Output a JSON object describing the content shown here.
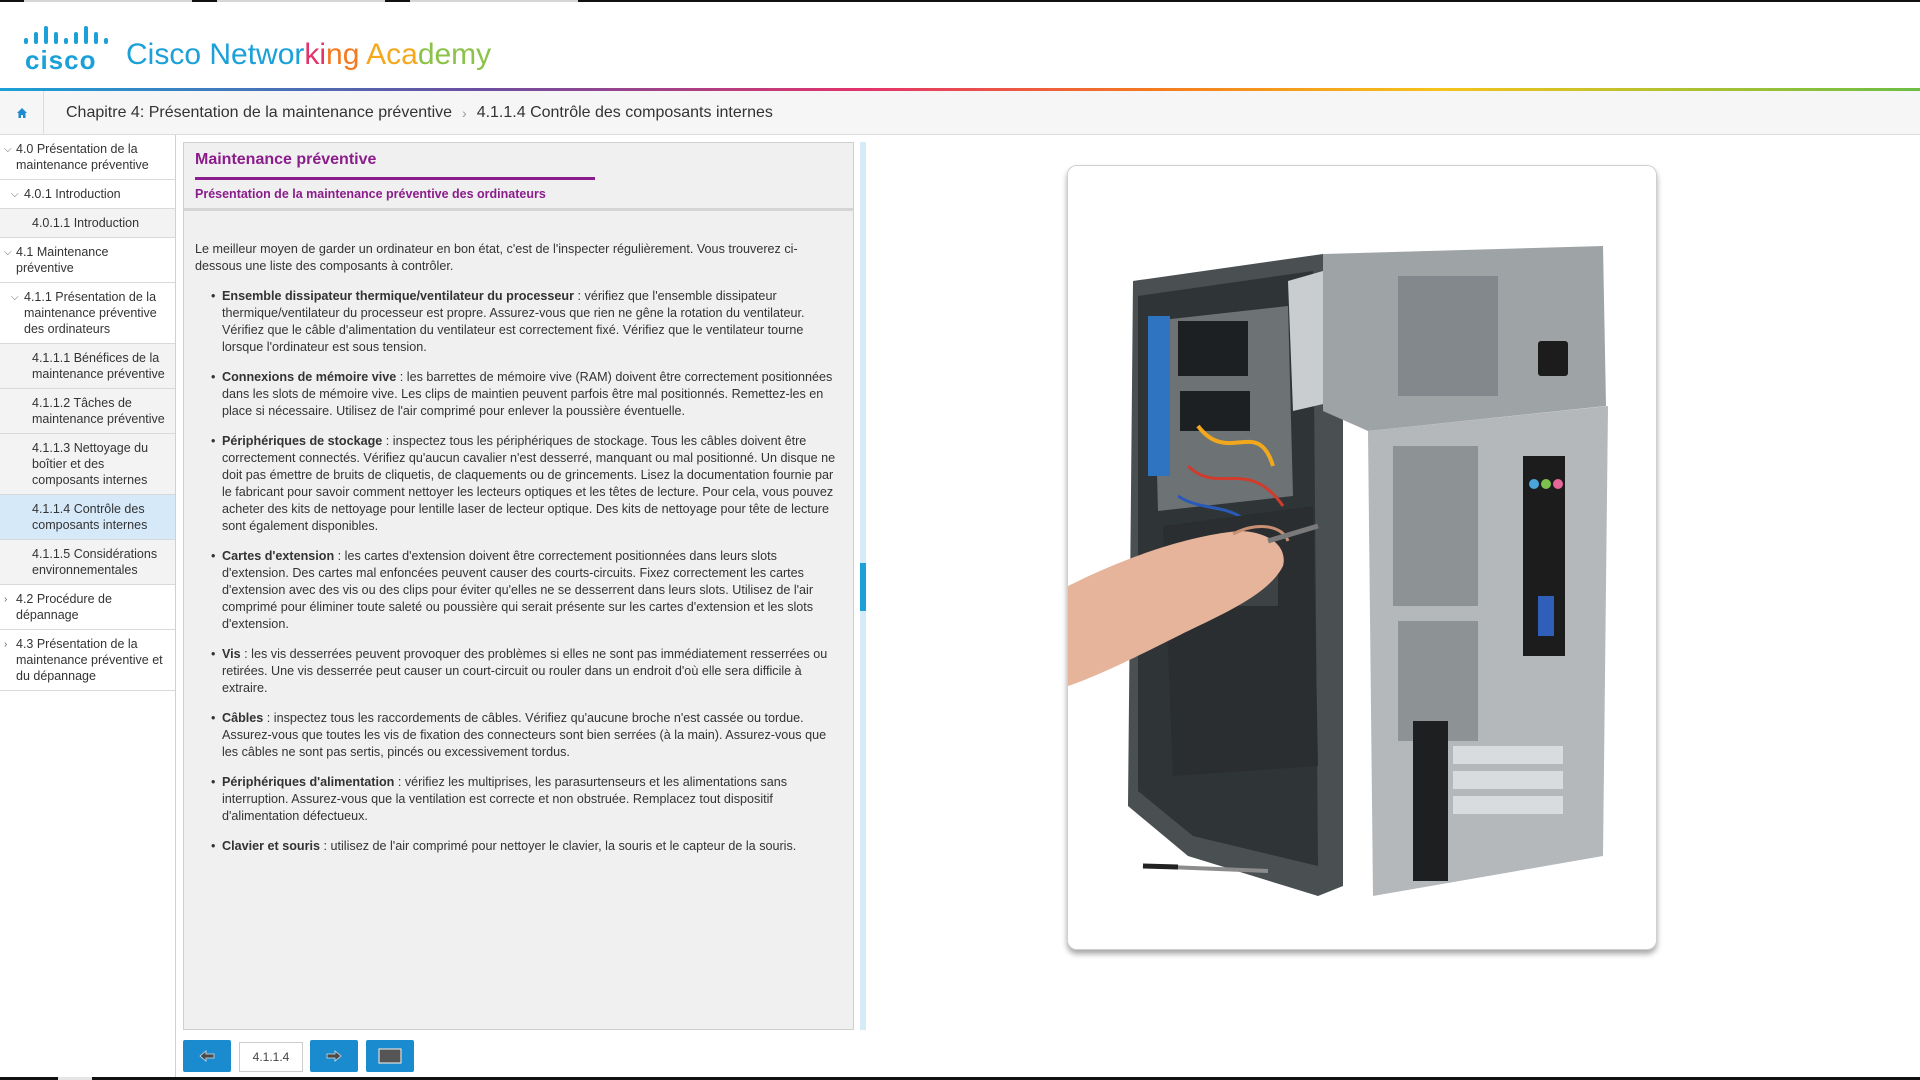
{
  "header": {
    "logo_text": "cisco",
    "title_parts": [
      {
        "text": "Cisco Networ",
        "color": "#1ba0d7"
      },
      {
        "text": "ki",
        "color": "#e2336b"
      },
      {
        "text": "ng ",
        "color": "#f47a20"
      },
      {
        "text": "Aca",
        "color": "#f5a81c"
      },
      {
        "text": "demy",
        "color": "#8bc34a"
      }
    ]
  },
  "breadcrumb": {
    "home_icon": "home-icon",
    "chapter": "Chapitre 4: Présentation de la maintenance préventive",
    "separator": "›",
    "current": "4.1.1.4 Contrôle des composants internes"
  },
  "sidebar": {
    "items": [
      {
        "label": "4.0 Présentation de la maintenance préventive",
        "level": 1,
        "expanded": true
      },
      {
        "label": "4.0.1 Introduction",
        "level": 2,
        "expanded": true
      },
      {
        "label": "4.0.1.1 Introduction",
        "level": 3
      },
      {
        "label": "4.1 Maintenance préventive",
        "level": 1,
        "expanded": true
      },
      {
        "label": "4.1.1 Présentation de la maintenance préventive des ordinateurs",
        "level": 2,
        "expanded": true
      },
      {
        "label": "4.1.1.1 Bénéfices de la maintenance préventive",
        "level": 3
      },
      {
        "label": "4.1.1.2 Tâches de maintenance préventive",
        "level": 3
      },
      {
        "label": "4.1.1.3 Nettoyage du boîtier et des composants internes",
        "level": 3
      },
      {
        "label": "4.1.1.4 Contrôle des composants internes",
        "level": 3,
        "active": true
      },
      {
        "label": "4.1.1.5 Considérations environnementales",
        "level": 3
      },
      {
        "label": "4.2 Procédure de dépannage",
        "level": 1,
        "expanded": false
      },
      {
        "label": "4.3 Présentation de la maintenance préventive et du dépannage",
        "level": 1,
        "expanded": false
      }
    ]
  },
  "content": {
    "title": "Maintenance préventive",
    "subtitle": "Présentation de la maintenance préventive des ordinateurs",
    "intro": "Le meilleur moyen de garder un ordinateur en bon état, c'est de l'inspecter régulièrement. Vous trouverez ci-dessous une liste des composants à contrôler.",
    "items": [
      {
        "term": "Ensemble dissipateur thermique/ventilateur du processeur",
        "text": " : vérifiez que l'ensemble dissipateur thermique/ventilateur du processeur est propre. Assurez-vous que rien ne gêne la rotation du ventilateur. Vérifiez que le câble d'alimentation du ventilateur est correctement fixé. Vérifiez que le ventilateur tourne lorsque l'ordinateur est sous tension."
      },
      {
        "term": "Connexions de mémoire vive",
        "text": " : les barrettes de mémoire vive (RAM) doivent être correctement positionnées dans les slots de mémoire vive. Les clips de maintien peuvent parfois être mal positionnés. Remettez-les en place si nécessaire. Utilisez de l'air comprimé pour enlever la poussière éventuelle."
      },
      {
        "term": "Périphériques de stockage",
        "text": " : inspectez tous les périphériques de stockage. Tous les câbles doivent être correctement connectés. Vérifiez qu'aucun cavalier n'est desserré, manquant ou mal positionné. Un disque ne doit pas émettre de bruits de cliquetis, de claquements ou de grincements. Lisez la documentation fournie par le fabricant pour savoir comment nettoyer les lecteurs optiques et les têtes de lecture. Pour cela, vous pouvez acheter des kits de nettoyage pour lentille laser de lecteur optique. Des kits de nettoyage pour tête de lecture sont également disponibles."
      },
      {
        "term": "Cartes d'extension",
        "text": " : les cartes d'extension doivent être correctement positionnées dans leurs slots d'extension. Des cartes mal enfoncées peuvent causer des courts-circuits. Fixez correctement les cartes d'extension avec des vis ou des clips pour éviter qu'elles ne se desserrent dans leurs slots. Utilisez de l'air comprimé pour éliminer toute saleté ou poussière qui serait présente sur les cartes d'extension et les slots d'extension."
      },
      {
        "term": "Vis",
        "text": " : les vis desserrées peuvent provoquer des problèmes si elles ne sont pas immédiatement resserrées ou retirées. Une vis desserrée peut causer un court-circuit ou rouler dans un endroit d'où elle sera difficile à extraire."
      },
      {
        "term": "Câbles",
        "text": " : inspectez tous les raccordements de câbles. Vérifiez qu'aucune broche n'est cassée ou tordue. Assurez-vous que toutes les vis de fixation des connecteurs sont bien serrées (à la main). Assurez-vous que les câbles ne sont pas sertis, pincés ou excessivement tordus."
      },
      {
        "term": "Périphériques d'alimentation",
        "text": " : vérifiez les multiprises, les parasurtenseurs et les alimentations sans interruption. Assurez-vous que la ventilation est correcte et non obstruée. Remplacez tout dispositif d'alimentation défectueux."
      },
      {
        "term": "Clavier et souris",
        "text": " : utilisez de l'air comprimé pour nettoyer le clavier, la souris et le capteur de la souris."
      }
    ]
  },
  "nav": {
    "prev_icon": "arrow-left-icon",
    "page_number": "4.1.1.4",
    "next_icon": "arrow-right-icon",
    "menu_icon": "panel-toggle-icon"
  },
  "image": {
    "subject": "computer-tower-internal-components-photo"
  },
  "colors": {
    "accent_blue": "#1ba0d7",
    "nav_button": "#1b8bd0",
    "title_purple": "#8b1c8c",
    "active_toc": "#d6e9f8"
  }
}
